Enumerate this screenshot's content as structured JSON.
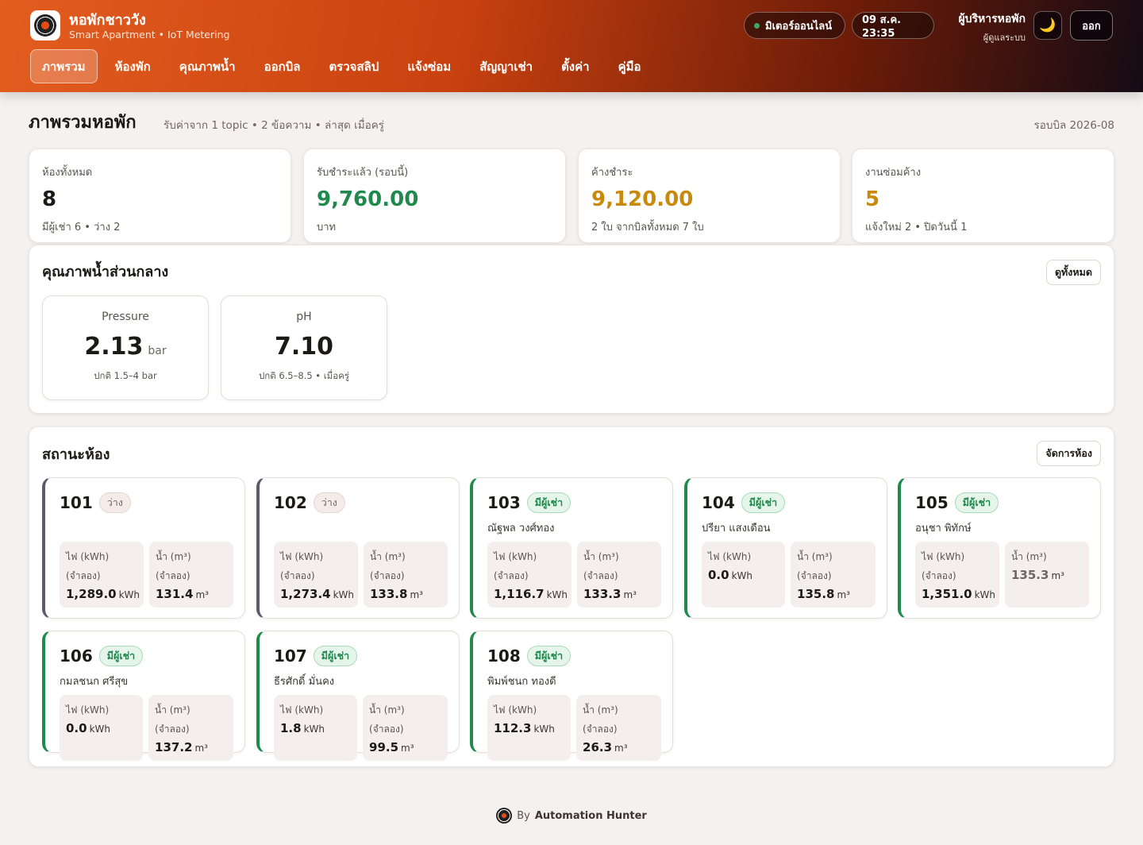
{
  "header": {
    "title": "หอพักชาววัง",
    "subtitle": "Smart Apartment • IoT Metering",
    "meter_status": "มิเตอร์ออนไลน์",
    "datetime": "09 ส.ค. 23:35",
    "user_name": "ผู้บริหารหอพัก",
    "user_role": "ผู้ดูแลระบบ",
    "theme_icon": "🌙",
    "logout_label": "ออก",
    "logo_icon": "gear-logo-icon"
  },
  "nav": [
    {
      "label": "ภาพรวม",
      "active": true
    },
    {
      "label": "ห้องพัก"
    },
    {
      "label": "คุณภาพน้ำ"
    },
    {
      "label": "ออกบิล"
    },
    {
      "label": "ตรวจสลิป"
    },
    {
      "label": "แจ้งซ่อม"
    },
    {
      "label": "สัญญาเช่า"
    },
    {
      "label": "ตั้งค่า"
    },
    {
      "label": "คู่มือ"
    }
  ],
  "page": {
    "title": "ภาพรวมหอพัก",
    "subtitle": "รับค่าจาก 1 topic • 2 ข้อความ • ล่าสุด เมื่อครู่",
    "billing_cycle": "รอบบิล 2026-08"
  },
  "stats": [
    {
      "label": "ห้องทั้งหมด",
      "value": "8",
      "note": "มีผู้เช่า 6 • ว่าง 2",
      "color": "#1c1a19"
    },
    {
      "label": "รับชำระแล้ว (รอบนี้)",
      "value": "9,760.00",
      "note": "บาท",
      "color": "#1f8a4c"
    },
    {
      "label": "ค้างชำระ",
      "value": "9,120.00",
      "note": "2 ใบ จากบิลทั้งหมด 7 ใบ",
      "color": "#c98a0c"
    },
    {
      "label": "งานซ่อมค้าง",
      "value": "5",
      "note": "แจ้งใหม่ 2 • ปิดวันนี้ 1",
      "color": "#c98a0c"
    }
  ],
  "water": {
    "title": "คุณภาพน้ำส่วนกลาง",
    "view_all": "ดูทั้งหมด",
    "gauges": [
      {
        "label": "Pressure",
        "value": "2.13",
        "unit": "bar",
        "note": "ปกติ 1.5–4 bar"
      },
      {
        "label": "pH",
        "value": "7.10",
        "unit": "",
        "note": "ปกติ 6.5–8.5 • เมื่อครู่"
      }
    ]
  },
  "rooms": {
    "title": "สถานะห้อง",
    "manage": "จัดการห้อง",
    "elec_unit": "kWh",
    "water_unit": "m³",
    "list": [
      {
        "no": "101",
        "status": "ว่าง",
        "vacant": true,
        "tenant": "",
        "elec_label": "ไฟ (kWh) (จำลอง)",
        "elec": "1,289.0",
        "water_label": "น้ำ (m³) (จำลอง)",
        "water": "131.4"
      },
      {
        "no": "102",
        "status": "ว่าง",
        "vacant": true,
        "tenant": "",
        "elec_label": "ไฟ (kWh) (จำลอง)",
        "elec": "1,273.4",
        "water_label": "น้ำ (m³) (จำลอง)",
        "water": "133.8"
      },
      {
        "no": "103",
        "status": "มีผู้เช่า",
        "tenant": "ณัฐพล วงศ์ทอง",
        "elec_label": "ไฟ (kWh) (จำลอง)",
        "elec": "1,116.7",
        "water_label": "น้ำ (m³) (จำลอง)",
        "water": "133.3"
      },
      {
        "no": "104",
        "status": "มีผู้เช่า",
        "tenant": "ปรียา แสงเดือน",
        "elec_label": "ไฟ (kWh)",
        "elec": "0.0",
        "water_label": "น้ำ (m³) (จำลอง)",
        "water": "135.8"
      },
      {
        "no": "105",
        "status": "มีผู้เช่า",
        "tenant": "อนุชา พิทักษ์",
        "elec_label": "ไฟ (kWh) (จำลอง)",
        "elec": "1,351.0",
        "water_label": "น้ำ (m³)",
        "water": "135.3",
        "water_dim": true
      },
      {
        "no": "106",
        "status": "มีผู้เช่า",
        "tenant": "กมลชนก ศรีสุข",
        "elec_label": "ไฟ (kWh)",
        "elec": "0.0",
        "water_label": "น้ำ (m³) (จำลอง)",
        "water": "137.2"
      },
      {
        "no": "107",
        "status": "มีผู้เช่า",
        "tenant": "ธีรศักดิ์ มั่นคง",
        "elec_label": "ไฟ (kWh)",
        "elec": "1.8",
        "water_label": "น้ำ (m³) (จำลอง)",
        "water": "99.5"
      },
      {
        "no": "108",
        "status": "มีผู้เช่า",
        "tenant": "พิมพ์ชนก ทองดี",
        "elec_label": "ไฟ (kWh)",
        "elec": "112.3",
        "water_label": "น้ำ (m³) (จำลอง)",
        "water": "26.3"
      }
    ]
  },
  "footer": {
    "by": "By",
    "brand": "Automation Hunter"
  }
}
